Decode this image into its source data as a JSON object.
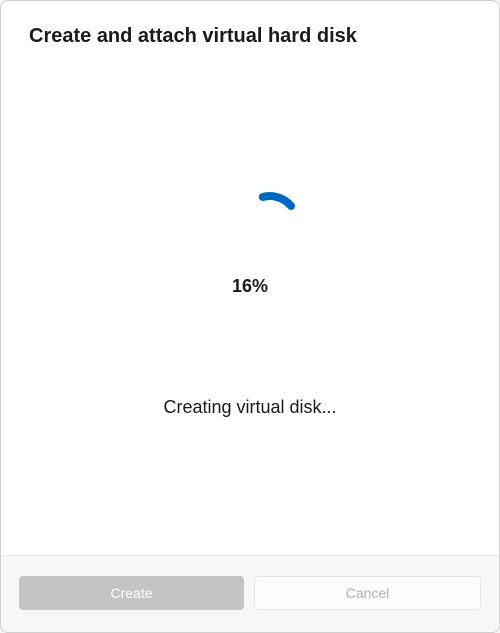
{
  "header": {
    "title": "Create and attach virtual hard disk"
  },
  "progress": {
    "percent_label": "16%",
    "percent_value": 16,
    "status_text": "Creating virtual disk...",
    "spinner_color": "#0067c0"
  },
  "footer": {
    "create_label": "Create",
    "cancel_label": "Cancel"
  }
}
